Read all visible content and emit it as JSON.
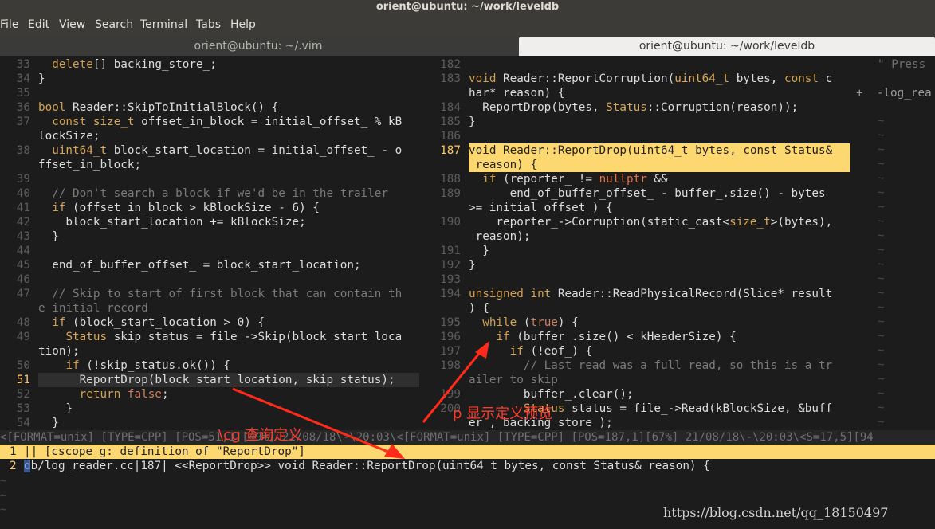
{
  "window": {
    "title": "orient@ubuntu: ~/work/leveldb"
  },
  "menu": [
    "File",
    "Edit",
    "View",
    "Search",
    "Terminal",
    "Tabs",
    "Help"
  ],
  "tabs": [
    {
      "label": "orient@ubuntu: ~/.vim",
      "active": false
    },
    {
      "label": "orient@ubuntu: ~/work/leveldb",
      "active": true
    }
  ],
  "left_pane": {
    "line_numbers": [
      "33",
      "34",
      "35",
      "36",
      "37",
      "",
      "38",
      "",
      "39",
      "40",
      "41",
      "42",
      "43",
      "44",
      "45",
      "46",
      "47",
      "",
      "48",
      "49",
      "",
      "50",
      "51",
      "52",
      "53",
      "54"
    ],
    "current_line": "51",
    "lines": [
      "  delete[] backing_store_;",
      "}",
      "",
      "bool Reader::SkipToInitialBlock() {",
      "  const size_t offset_in_block = initial_offset_ % kB",
      "lockSize;",
      "  uint64_t block_start_location = initial_offset_ - o",
      "ffset_in_block;",
      "",
      "  // Don't search a block if we'd be in the trailer",
      "  if (offset_in_block > kBlockSize - 6) {",
      "    block_start_location += kBlockSize;",
      "  }",
      "",
      "  end_of_buffer_offset_ = block_start_location;",
      "",
      "  // Skip to start of first block that can contain th",
      "e initial record",
      "  if (block_start_location > 0) {",
      "    Status skip_status = file_->Skip(block_start_loca",
      "tion);",
      "    if (!skip_status.ok()) {",
      "      ReportDrop(block_start_location, skip_status);",
      "      return false;",
      "    }",
      "  }"
    ]
  },
  "right_pane": {
    "line_numbers": [
      "182",
      "183",
      "",
      "184",
      "185",
      "186",
      "187",
      "",
      "188",
      "189",
      "",
      "190",
      "",
      "191",
      "192",
      "193",
      "194",
      "",
      "195",
      "196",
      "197",
      "198",
      "",
      "199",
      "200",
      ""
    ],
    "current_line": "187",
    "lines": [
      "",
      "void Reader::ReportCorruption(uint64_t bytes, const c",
      "har* reason) {",
      "  ReportDrop(bytes, Status::Corruption(reason));",
      "}",
      "",
      "void Reader::ReportDrop(uint64_t bytes, const Status&",
      " reason) {",
      "  if (reporter_ != nullptr &&",
      "      end_of_buffer_offset_ - buffer_.size() - bytes",
      ">= initial_offset_) {",
      "    reporter_->Corruption(static_cast<size_t>(bytes),",
      " reason);",
      "  }",
      "}",
      "",
      "unsigned int Reader::ReadPhysicalRecord(Slice* result",
      ") {",
      "  while (true) {",
      "    if (buffer_.size() < kHeaderSize) {",
      "      if (!eof_) {",
      "        // Last read was a full read, so this is a tr",
      "ailer to skip",
      "        buffer_.clear();",
      "        Status status = file_->Read(kBlockSize, &buff",
      "er_, backing_store_);"
    ]
  },
  "side_pane": {
    "lines": [
      "\" Press",
      "+  -log_rea"
    ]
  },
  "status_line": "<[FORMAT=unix] [TYPE=CPP] [POS=51,1][49%] 21/08/18\\-\\20:03\\<[FORMAT=unix] [TYPE=CPP] [POS=187,1][67%] 21/08/18\\-\\20:03\\<S=17,5][94",
  "quickfix": [
    {
      "num": "1",
      "text": "|| [cscope g: definition of \"ReportDrop\"]"
    },
    {
      "num": "2",
      "text": "db/log_reader.cc|187| <<ReportDrop>> void Reader::ReportDrop(uint64_t bytes, const Status& reason) {"
    }
  ],
  "annotations": {
    "cg": "\\cg 查询定义",
    "p": "p 显示定义预览"
  },
  "watermark": "https://blog.csdn.net/qq_18150497",
  "colors": {
    "annotation": "#ff3a2a",
    "highlight": "#fdd770"
  }
}
